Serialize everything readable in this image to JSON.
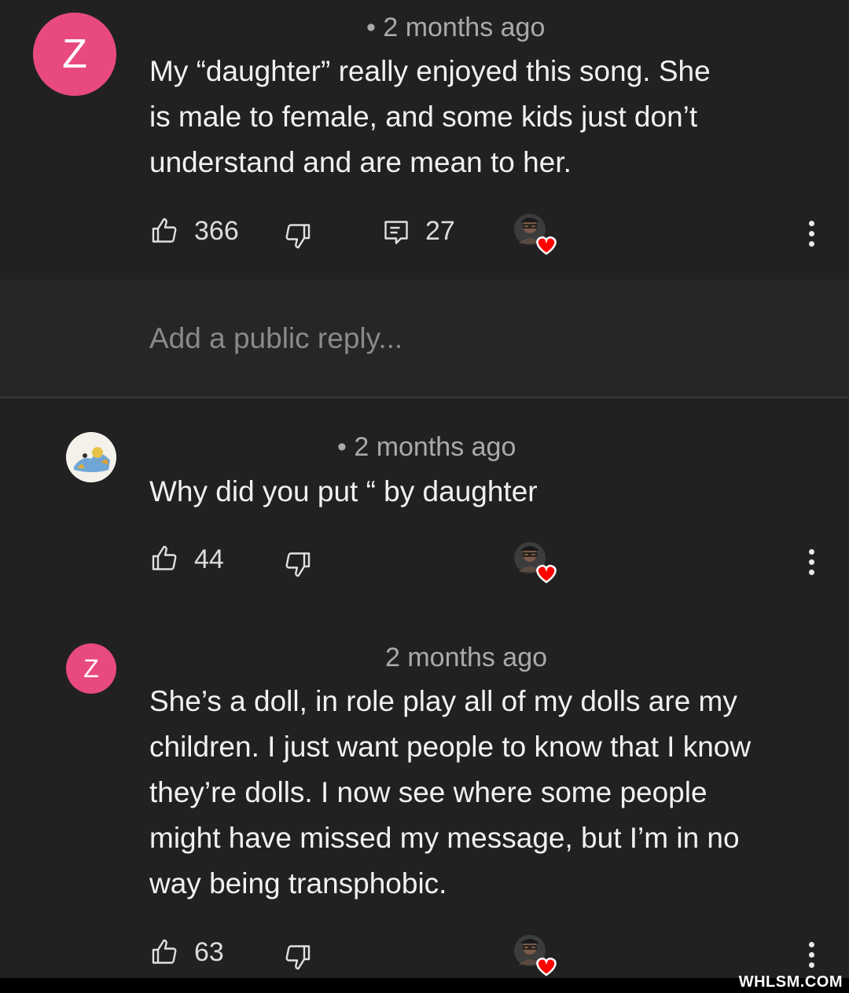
{
  "comments": [
    {
      "avatar_letter": "Z",
      "time": "• 2 months ago",
      "text_lines": [
        "My “daughter” really enjoyed this song. She",
        "is male to female, and some kids just don’t",
        "understand and are mean to her."
      ],
      "likes": "366",
      "replies": "27"
    },
    {
      "time": "• 2 months ago",
      "text_lines": [
        "Why did you put “ by daughter"
      ],
      "likes": "44"
    },
    {
      "avatar_letter": "Z",
      "time": "2 months ago",
      "text_lines": [
        "She’s a doll, in role play all of my dolls are my",
        "children. I just want people to know that I know",
        "they’re dolls. I now see where some people",
        "might have missed my message, but I’m in no",
        "way being transphobic."
      ],
      "likes": "63"
    }
  ],
  "reply_box": {
    "placeholder": "Add a public reply..."
  },
  "watermark": "WHLSM.COM",
  "colors": {
    "avatar_pink": "#e84a80",
    "heart_red": "#ff0000",
    "background": "#212121"
  }
}
